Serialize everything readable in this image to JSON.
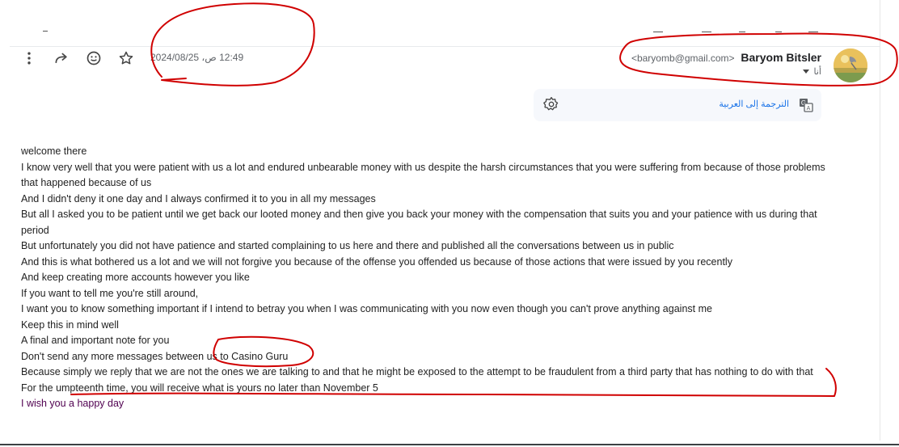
{
  "window": {
    "minimize_glyph": "–"
  },
  "toolbar": {
    "icons": [
      "more-vert-icon",
      "forward-icon",
      "emoji-icon",
      "star-icon"
    ]
  },
  "message": {
    "timestamp": "12:49 ص، 2024/08/25",
    "sender_name": "Baryom Bitsler",
    "sender_email": "<baryomb@gmail.com>",
    "recipient_label": "أنا"
  },
  "translate": {
    "link_text": "الترجمة إلى العربية"
  },
  "body_lines": [
    "welcome there",
    "I know very well that you were patient with us a lot and endured unbearable money with us despite the harsh circumstances that you were suffering from because of those problems that happened because of us",
    "And I didn't deny it one day and I always confirmed it to you in all my messages",
    "But all I asked you to be patient until we get back our looted money and then give you back your money with the compensation that suits you and your patience with us during that period",
    "But unfortunately you did not have patience and started complaining to us here and there and published all the conversations between us in public",
    "And this is what bothered us a lot and we will not forgive you because of the offense you offended us because of those actions that were issued by you recently",
    "And keep creating more accounts however you like",
    "If you want to tell me you're still around,",
    "I want you to know something important if I intend to betray you when I was communicating with you now even though you can't prove anything against me",
    "Keep this in mind well",
    "A final and important note for you",
    "Don't send any more messages between us to Casino Guru",
    "Because simply we reply that we are not the ones we are talking to and that he might be exposed to the attempt to be fraudulent from a third party that has nothing to do with that",
    "For the umpteenth time, you will receive what is yours no later than November 5",
    "I wish you a happy day"
  ],
  "colors": {
    "annotation": "#d00000",
    "link": "#1a73e8",
    "signature": "#500050"
  }
}
